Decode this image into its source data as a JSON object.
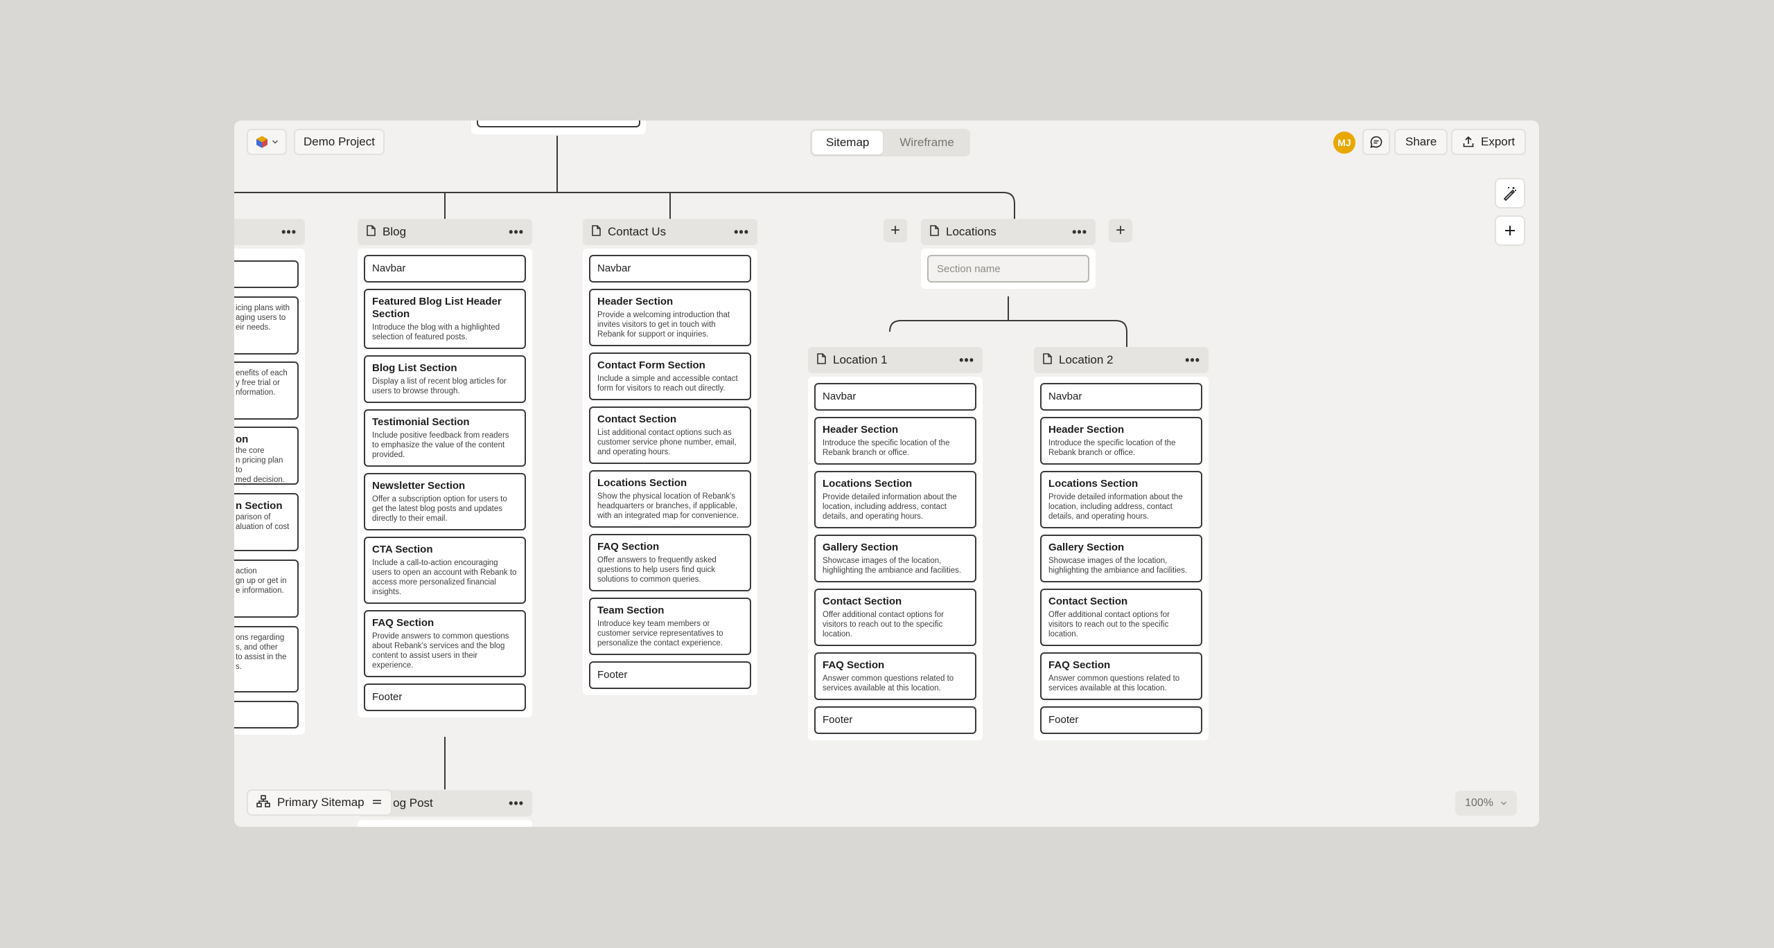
{
  "toolbar": {
    "project_name": "Demo Project",
    "tabs": [
      {
        "label": "Sitemap",
        "active": true
      },
      {
        "label": "Wireframe",
        "active": false
      }
    ],
    "avatar_initials": "MJ",
    "share_label": "Share",
    "export_label": "Export"
  },
  "colors": {
    "canvas_bg": "#f2f1ef",
    "page_bg": "#d9d8d4",
    "avatar": "#e8a800",
    "node_header": "#e5e4e1",
    "section_border": "#3a3a3a"
  },
  "sitemap_label": "Primary Sitemap",
  "zoom_label": "100%",
  "left_partial": {
    "fragments": [
      {
        "text": ""
      },
      {
        "text": "icing plans with\naging users to\neir needs."
      },
      {
        "text": "enefits of each\ny free trial or\nnformation."
      },
      {
        "name": "on",
        "text": "the core\nn pricing plan to\nmed decision."
      },
      {
        "name": "n Section",
        "text": "parison of\naluation of cost"
      },
      {
        "text": "action\ngn up or get in\ne information."
      },
      {
        "text": "ons regarding\ns, and other\nto assist in the\ns."
      },
      {
        "text": ""
      }
    ]
  },
  "pages": {
    "blog": {
      "title": "Blog",
      "sections": [
        {
          "name": "Navbar"
        },
        {
          "name": "Featured Blog List Header Section",
          "desc": "Introduce the blog with a highlighted selection of featured posts."
        },
        {
          "name": "Blog List Section",
          "desc": "Display a list of recent blog articles for users to browse through."
        },
        {
          "name": "Testimonial Section",
          "desc": "Include positive feedback from readers to emphasize the value of the content provided."
        },
        {
          "name": "Newsletter Section",
          "desc": "Offer a subscription option for users to get the latest blog posts and updates directly to their email."
        },
        {
          "name": "CTA Section",
          "desc": "Include a call-to-action encouraging users to open an account with Rebank to access more personalized financial insights."
        },
        {
          "name": "FAQ Section",
          "desc": "Provide answers to common questions about Rebank's services and the blog content to assist users in their experience."
        },
        {
          "name": "Footer"
        }
      ]
    },
    "contact": {
      "title": "Contact Us",
      "sections": [
        {
          "name": "Navbar"
        },
        {
          "name": "Header Section",
          "desc": "Provide a welcoming introduction that invites visitors to get in touch with Rebank for support or inquiries."
        },
        {
          "name": "Contact Form Section",
          "desc": "Include a simple and accessible contact form for visitors to reach out directly."
        },
        {
          "name": "Contact Section",
          "desc": "List additional contact options such as customer service phone number, email, and operating hours."
        },
        {
          "name": "Locations Section",
          "desc": "Show the physical location of Rebank's headquarters or branches, if applicable, with an integrated map for convenience."
        },
        {
          "name": "FAQ Section",
          "desc": "Offer answers to frequently asked questions to help users find quick solutions to common queries."
        },
        {
          "name": "Team Section",
          "desc": "Introduce key team members or customer service representatives to personalize the contact experience."
        },
        {
          "name": "Footer"
        }
      ]
    },
    "locations": {
      "title": "Locations",
      "section_placeholder": "Section name"
    },
    "location1": {
      "title": "Location 1",
      "sections": [
        {
          "name": "Navbar"
        },
        {
          "name": "Header Section",
          "desc": "Introduce the specific location of the Rebank branch or office."
        },
        {
          "name": "Locations Section",
          "desc": "Provide detailed information about the location, including address, contact details, and operating hours."
        },
        {
          "name": "Gallery Section",
          "desc": "Showcase images of the location, highlighting the ambiance and facilities."
        },
        {
          "name": "Contact Section",
          "desc": "Offer additional contact options for visitors to reach out to the specific location."
        },
        {
          "name": "FAQ Section",
          "desc": "Answer common questions related to services available at this location."
        },
        {
          "name": "Footer"
        }
      ]
    },
    "location2": {
      "title": "Location 2",
      "sections": [
        {
          "name": "Navbar"
        },
        {
          "name": "Header Section",
          "desc": "Introduce the specific location of the Rebank branch or office."
        },
        {
          "name": "Locations Section",
          "desc": "Provide detailed information about the location, including address, contact details, and operating hours."
        },
        {
          "name": "Gallery Section",
          "desc": "Showcase images of the location, highlighting the ambiance and facilities."
        },
        {
          "name": "Contact Section",
          "desc": "Offer additional contact options for visitors to reach out to the specific location."
        },
        {
          "name": "FAQ Section",
          "desc": "Answer common questions related to services available at this location."
        },
        {
          "name": "Footer"
        }
      ]
    },
    "blog_post": {
      "title": "Blog Post"
    }
  }
}
